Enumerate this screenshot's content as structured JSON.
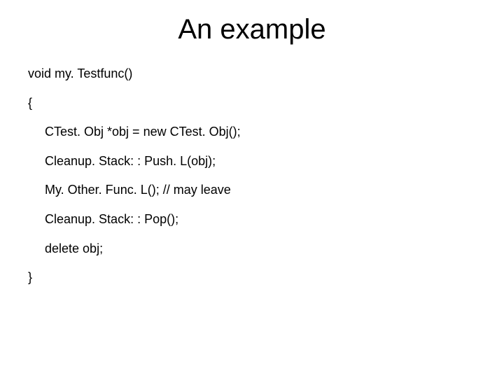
{
  "title": "An example",
  "code": {
    "l1": "void my. Testfunc()",
    "l2": "{",
    "l3": "CTest. Obj *obj = new CTest. Obj();",
    "l4": "Cleanup. Stack: : Push. L(obj);",
    "l5": "My. Other. Func. L(); // may leave",
    "l6": "Cleanup. Stack: : Pop();",
    "l7": "delete obj;",
    "l8": "}"
  }
}
